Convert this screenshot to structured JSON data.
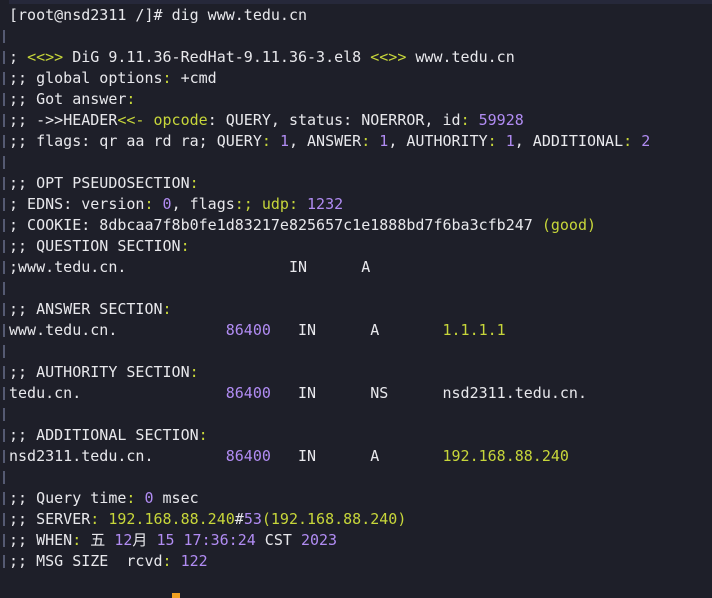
{
  "prompt": {
    "text": "[root@nsd2311 /]# ",
    "command": "dig www.tedu.cn"
  },
  "lines": {
    "banner_a": "; ",
    "banner_b": "<<>>",
    "banner_c": " DiG 9.11.36-RedHat-9.11.36-3.el8 ",
    "banner_d": "<<>>",
    "banner_e": " www.tedu.cn",
    "global_a": ";; global options",
    "global_b": ": ",
    "global_c": "+cmd",
    "got_a": ";; Got answer",
    "got_b": ":",
    "hdr_a": ";; ->>",
    "hdr_b": "HEADER",
    "hdr_c": "<<- opcode",
    "hdr_d": ": QUERY, status",
    "hdr_e": ": NOERROR, id",
    "hdr_f": ": ",
    "hdr_id": "59928",
    "flags_a": ";; flags",
    "flags_b": ": qr aa rd ra; QUERY",
    "flags_c": ": ",
    "flags_q": "1",
    "flags_d": ", ANSWER",
    "flags_e": ": ",
    "flags_an": "1",
    "flags_f": ", AUTHORITY",
    "flags_g": ": ",
    "flags_au": "1",
    "flags_h": ", ADDITIONAL",
    "flags_i": ": ",
    "flags_ad": "2",
    "opt_a": ";; OPT PSEUDOSECTION",
    "opt_b": ":",
    "edns_a": "; EDNS",
    "edns_b": ": version",
    "edns_c": ": ",
    "edns_ver": "0",
    "edns_d": ", flags",
    "edns_e": ":; udp",
    "edns_f": ": ",
    "edns_udp": "1232",
    "cookie_a": "; COOKIE",
    "cookie_b": ": 8dbcaa7f8b0fe1d83217e825657c1e1888bd7f6ba3cfb247 ",
    "cookie_c": "(good)",
    "q_sec_a": ";; QUESTION SECTION",
    "q_sec_b": ":",
    "q_row": ";www.tedu.cn.                  IN      A",
    "an_sec_a": ";; ANSWER SECTION",
    "an_sec_b": ":",
    "an_row_a": "www.tedu.cn.            ",
    "an_ttl": "86400",
    "an_row_b": "   IN      A       ",
    "an_ip": "1.1.1.1",
    "au_sec_a": ";; AUTHORITY SECTION",
    "au_sec_b": ":",
    "au_row_a": "tedu.cn.                ",
    "au_ttl": "86400",
    "au_row_b": "   IN      NS      nsd2311.tedu.cn.",
    "ad_sec_a": ";; ADDITIONAL SECTION",
    "ad_sec_b": ":",
    "ad_row_a": "nsd2311.tedu.cn.        ",
    "ad_ttl": "86400",
    "ad_row_b": "   IN      A       ",
    "ad_ip": "192.168.88.240",
    "qt_a": ";; Query time",
    "qt_b": ": ",
    "qt_val": "0",
    "qt_c": " msec",
    "srv_a": ";; SERVER",
    "srv_b": ": ",
    "srv_ip": "192.168.88.240",
    "srv_c": "#",
    "srv_port": "53",
    "srv_d": "(192.168.88.240)",
    "when_a": ";; WHEN",
    "when_b": ": ",
    "when_day": "五",
    "when_sp1": " ",
    "when_mon": "12",
    "when_monch": "月",
    "when_sp2": " ",
    "when_date": "15",
    "when_sp3": " ",
    "when_time": "17:36:24",
    "when_tz": " CST ",
    "when_year": "2023",
    "msg_a": ";; MSG SIZE  rcvd",
    "msg_b": ": ",
    "msg_val": "122"
  },
  "colors": {
    "background": "#1e1f29",
    "text": "#e8e8ec",
    "punctuation": "#c7d63a",
    "number": "#b18cf3",
    "cursor": "#f0a020"
  }
}
